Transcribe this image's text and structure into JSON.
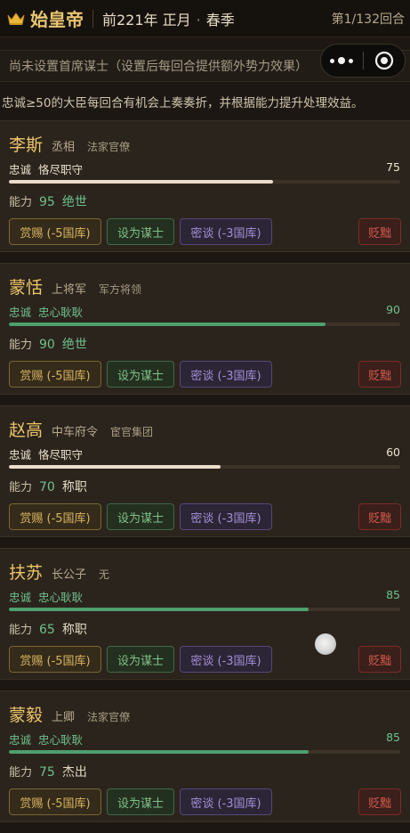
{
  "header": {
    "title": "始皇帝",
    "year": "前221年",
    "month": "正月",
    "season": "春季",
    "separator": "·",
    "round": "第1/132回合"
  },
  "advisor": {
    "text": "尚未设置首席谋士（设置后每回合提供额外势力效果）"
  },
  "hint": "忠诚≥50的大臣每回合有机会上奏奏折，并根据能力提升处理效益。",
  "colors": {
    "loyal_fill": "#ecdccb",
    "devoted_fill": "#4e9f6e",
    "gold": "#ecc56a",
    "background": "#1c1712"
  },
  "buttons": {
    "reward": "赏赐 (-5国库)",
    "set_advisor": "设为谋士",
    "secret_talk": "密谈 (-3国库)",
    "demote": "贬黜"
  },
  "ministers": [
    {
      "name": "李斯",
      "post": "丞相",
      "faction": "法家官僚",
      "loyalty_label": "忠诚",
      "loyalty_status": "恪尽职守",
      "loyalty": 75,
      "ability_label": "能力",
      "ability": 95,
      "ability_level": "绝世"
    },
    {
      "name": "蒙恬",
      "post": "上将军",
      "faction": "军方将领",
      "loyalty_label": "忠诚",
      "loyalty_status": "忠心耿耿",
      "loyalty": 90,
      "ability_label": "能力",
      "ability": 90,
      "ability_level": "绝世"
    },
    {
      "name": "赵高",
      "post": "中车府令",
      "faction": "宦官集团",
      "loyalty_label": "忠诚",
      "loyalty_status": "恪尽职守",
      "loyalty": 60,
      "ability_label": "能力",
      "ability": 70,
      "ability_level": "称职"
    },
    {
      "name": "扶苏",
      "post": "长公子",
      "faction": "无",
      "loyalty_label": "忠诚",
      "loyalty_status": "忠心耿耿",
      "loyalty": 85,
      "ability_label": "能力",
      "ability": 65,
      "ability_level": "称职"
    },
    {
      "name": "蒙毅",
      "post": "上卿",
      "faction": "法家官僚",
      "loyalty_label": "忠诚",
      "loyalty_status": "忠心耿耿",
      "loyalty": 85,
      "ability_label": "能力",
      "ability": 75,
      "ability_level": "杰出"
    }
  ]
}
